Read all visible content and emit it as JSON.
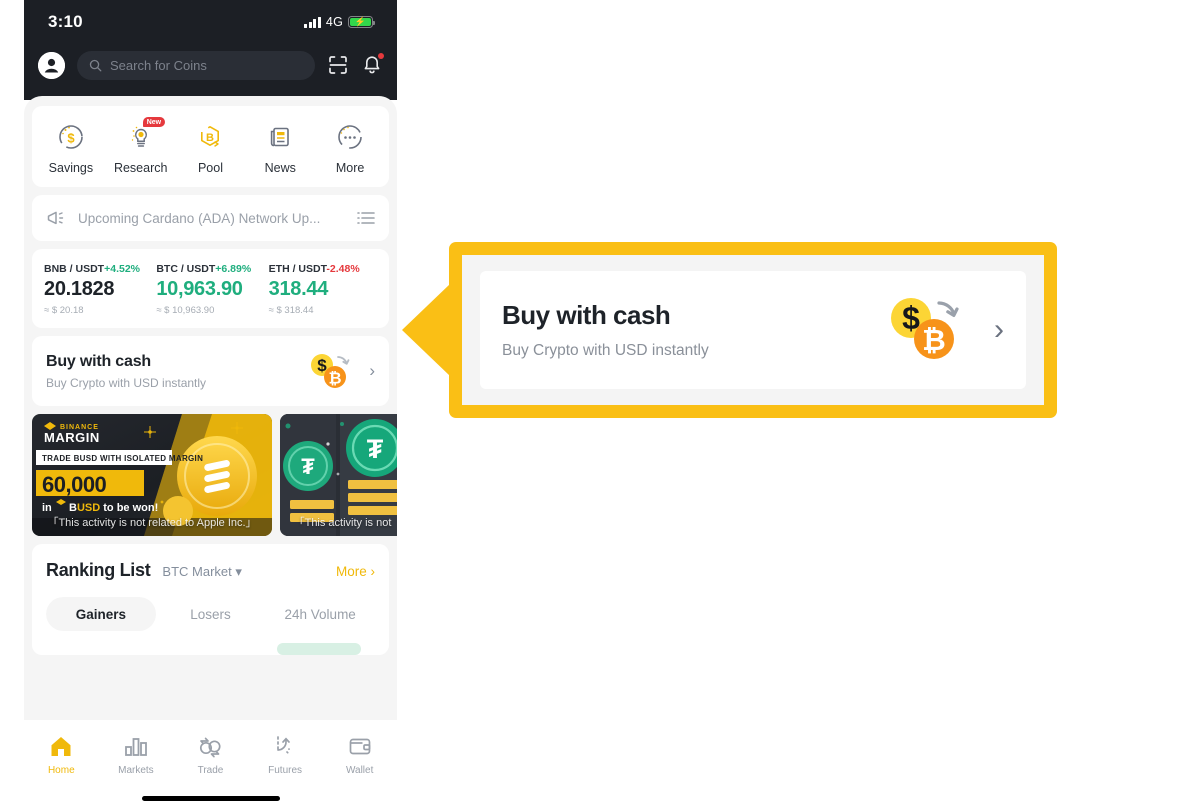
{
  "phone": {
    "status_bar": {
      "time": "3:10",
      "network": "4G",
      "signal_icon": "signal-bars-icon",
      "battery_icon": "battery-charging-icon"
    },
    "header": {
      "avatar_icon": "user-avatar-icon",
      "search_placeholder": "Search for Coins",
      "search_icon": "search-icon",
      "scan_icon": "qr-scan-icon",
      "bell_icon": "notification-bell-icon",
      "bell_has_dot": true
    },
    "quick_actions": [
      {
        "label": "Savings",
        "icon": "savings-dollar-coin-icon",
        "badge": ""
      },
      {
        "label": "Research",
        "icon": "research-lightbulb-icon",
        "badge": "New"
      },
      {
        "label": "Pool",
        "icon": "pool-bitcoin-box-icon",
        "badge": ""
      },
      {
        "label": "News",
        "icon": "news-document-icon",
        "badge": ""
      },
      {
        "label": "More",
        "icon": "more-dots-circle-icon",
        "badge": ""
      }
    ],
    "announcement": {
      "icon": "megaphone-icon",
      "text": "Upcoming Cardano (ADA) Network Up...",
      "list_icon": "list-lines-icon"
    },
    "tickers": [
      {
        "pair": "BNB / USDT",
        "change": "+4.52%",
        "direction": "up",
        "price": "20.1828",
        "price_color": "neutral",
        "usd": "≈ $  20.18"
      },
      {
        "pair": "BTC / USDT",
        "change": "+6.89%",
        "direction": "up",
        "price": "10,963.90",
        "price_color": "up",
        "usd": "≈ $  10,963.90"
      },
      {
        "pair": "ETH / USDT",
        "change": "-2.48%",
        "direction": "down",
        "price": "318.44",
        "price_color": "up",
        "usd": "≈ $  318.44"
      }
    ],
    "buy_with_cash": {
      "title": "Buy with cash",
      "subtitle": "Buy Crypto with USD instantly",
      "icon": "dollar-to-bitcoin-swap-icon",
      "chevron": "›"
    },
    "banners": [
      {
        "brand": "BINANCE",
        "product": "MARGIN",
        "tagline": "TRADE BUSD WITH ISOLATED MARGIN",
        "amount": "60,000",
        "prize_line": "in ✦ BUSD to be won!",
        "note": "「This activity is not related to Apple Inc.」"
      },
      {
        "note": "「This activity is not"
      }
    ],
    "ranking": {
      "title": "Ranking List",
      "market": "BTC Market",
      "market_caret": "▾",
      "more": "More ›",
      "tabs": [
        {
          "label": "Gainers",
          "active": true
        },
        {
          "label": "Losers",
          "active": false
        },
        {
          "label": "24h Volume",
          "active": false
        }
      ]
    },
    "bottom_nav": [
      {
        "label": "Home",
        "icon": "home-icon",
        "active": true
      },
      {
        "label": "Markets",
        "icon": "bar-chart-icon",
        "active": false
      },
      {
        "label": "Trade",
        "icon": "trade-swap-icon",
        "active": false
      },
      {
        "label": "Futures",
        "icon": "futures-arrow-icon",
        "active": false
      },
      {
        "label": "Wallet",
        "icon": "wallet-icon",
        "active": false
      }
    ]
  },
  "callout": {
    "title": "Buy with cash",
    "subtitle": "Buy Crypto with USD instantly",
    "icon": "dollar-to-bitcoin-swap-icon",
    "chevron": "›"
  },
  "colors": {
    "brand_yellow": "#f0b90b",
    "callout_border": "#fabf15",
    "up_green": "#1fae7e",
    "down_red": "#e5393d",
    "bitcoin_orange": "#f7931a",
    "dark_bg": "#1c1f25"
  }
}
